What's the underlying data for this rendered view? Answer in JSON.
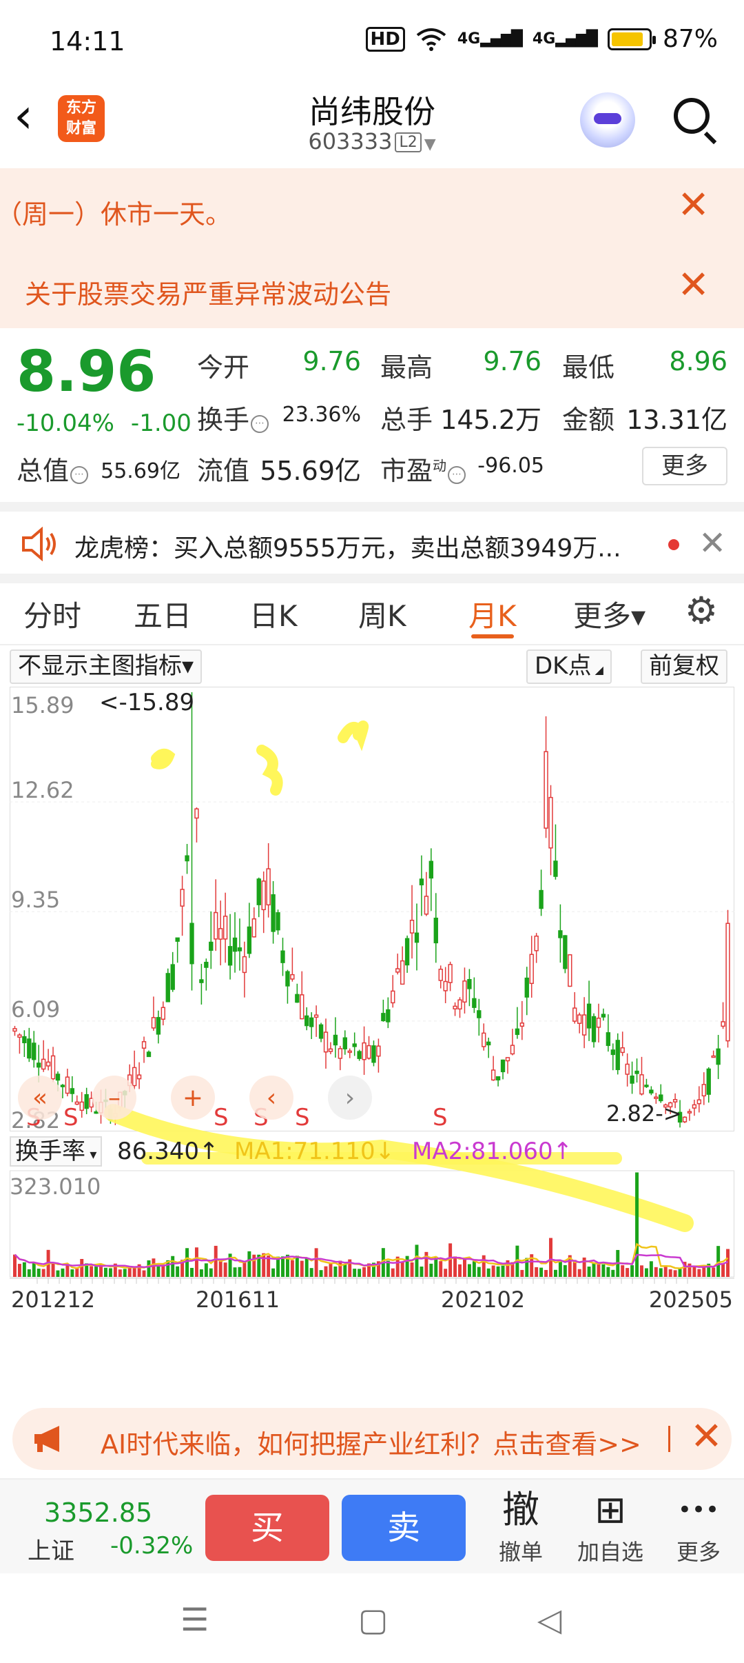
{
  "status": {
    "time": "14:11",
    "hd": "HD",
    "net1": "4G",
    "net2": "4G",
    "battery": "87%"
  },
  "header": {
    "logo_line1": "东方",
    "logo_line2": "财富",
    "name": "尚纬股份",
    "code": "603333",
    "level": "L2"
  },
  "notices": [
    {
      "text": "（周一）休市一天。"
    },
    {
      "text": "关于股票交易严重异常波动公告"
    }
  ],
  "quote": {
    "price": "8.96",
    "change_pct": "-10.04%",
    "change": "-1.00",
    "open_label": "今开",
    "open": "9.76",
    "high_label": "最高",
    "high": "9.76",
    "low_label": "最低",
    "low": "8.96",
    "turnover_label": "换手",
    "turnover": "23.36%",
    "volume_label": "总手",
    "volume": "145.2万",
    "amount_label": "金额",
    "amount": "13.31亿",
    "mktcap_label": "总值",
    "mktcap": "55.69亿",
    "float_label": "流值",
    "float": "55.69亿",
    "pe_label": "市盈",
    "pe_sup": "动",
    "pe": "-96.05",
    "more": "更多"
  },
  "dragon": {
    "text": "龙虎榜：买入总额9555万元，卖出总额3949万..."
  },
  "tabs": [
    {
      "label": "分时"
    },
    {
      "label": "五日"
    },
    {
      "label": "日K"
    },
    {
      "label": "周K"
    },
    {
      "label": "月K"
    },
    {
      "label": "更多▾"
    }
  ],
  "toolbar": {
    "indicator": "不显示主图指标▾",
    "dk": "DK点",
    "adjust": "前复权"
  },
  "chart_data": {
    "type": "candlestick",
    "price_ticks": [
      "15.89",
      "12.62",
      "9.35",
      "6.09",
      "2.82"
    ],
    "ylim": [
      2.82,
      15.89
    ],
    "max_label": "<-15.89",
    "min_label": "2.82->",
    "signal_marker": "S",
    "controls": [
      "«",
      "–",
      "+",
      "‹",
      "›"
    ],
    "indicator": {
      "name": "换手率",
      "value": "86.340↑",
      "ma1": "MA1:71.110↓",
      "ma2": "MA2:81.060↑",
      "max": "323.010"
    },
    "x_labels": [
      "201212",
      "201611",
      "202102",
      "202505"
    ],
    "colors": {
      "up": "#e23a3a",
      "down": "#1aa31a",
      "ma1": "#f0c419",
      "ma2": "#c93ad0"
    }
  },
  "ad": {
    "text": "AI时代来临，如何把握产业红利？点击查看>>"
  },
  "tradebar": {
    "index_value": "3352.85",
    "index_name": "上证",
    "index_change": "-0.32%",
    "buy": "买",
    "sell": "卖",
    "cancel_icon": "撤",
    "cancel": "撤单",
    "watch_icon": "⊞",
    "watch": "加自选",
    "more_icon": "•••",
    "more": "更多"
  }
}
